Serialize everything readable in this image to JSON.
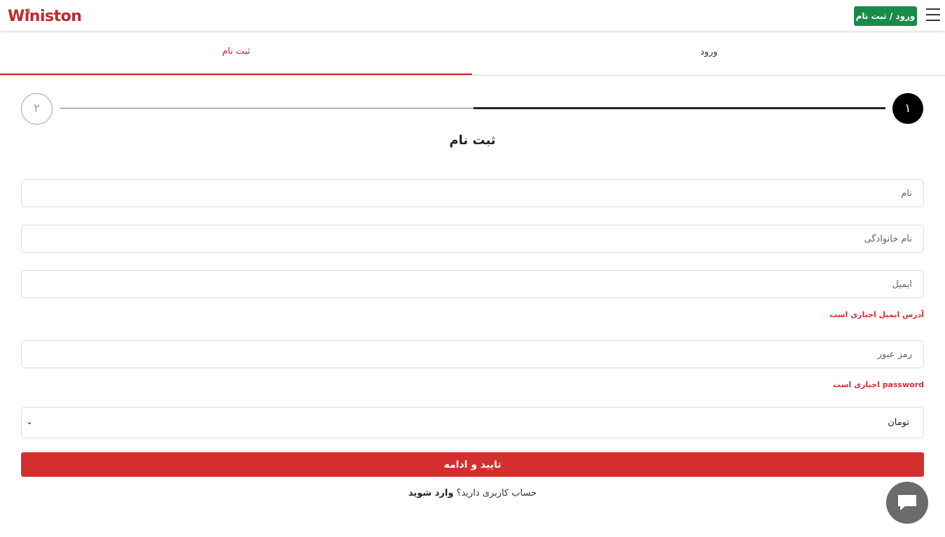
{
  "header": {
    "logo_text": "Winiston",
    "login_register_label": "ورود / ثبت نام"
  },
  "tabs": [
    {
      "label": "ثبت نام",
      "active": true
    },
    {
      "label": "ورود",
      "active": false
    }
  ],
  "stepper": {
    "step1": "۱",
    "step2": "۲",
    "current": 1
  },
  "form": {
    "title": "ثبت نام",
    "first_name_placeholder": "نام",
    "last_name_placeholder": "نام خانوادگی",
    "email_placeholder": "ایمیل",
    "email_error": "آدرس ایمیل اجباری است",
    "password_placeholder": "رمز عبور",
    "password_error": "password اجباری است",
    "currency_selected": "تومان",
    "submit_label": "تایید و ادامه",
    "have_account_text": "حساب کاربری دارید؟",
    "login_link_text": "وارد شوید"
  },
  "colors": {
    "brand_red": "#c0282c",
    "header_green": "#1a8a4a",
    "submit_red": "#d32f2f",
    "error_red": "#d0303a"
  }
}
